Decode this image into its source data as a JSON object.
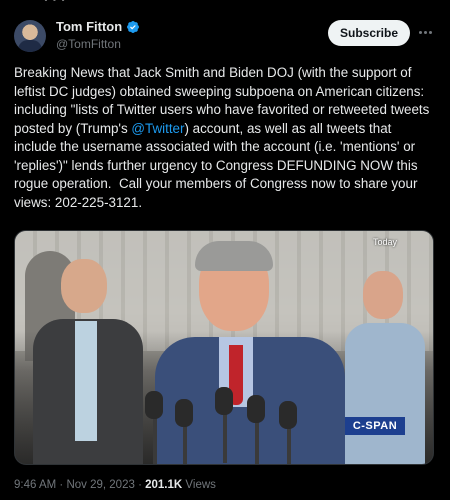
{
  "tweet": {
    "author_name": "Tom Fitton",
    "author_handle": "@TomFitton",
    "subscribe_label": "Subscribe",
    "text_before": "Breaking News that Jack Smith and Biden DOJ (with the support of leftist DC judges) obtained sweeping subpoena on American citizens: including \"lists of Twitter users who have favorited or retweeted tweets posted by (Trump's ",
    "mention": "@Twitter",
    "text_after": ") account, as well as all tweets that include the username associated with the account (i.e. 'mentions' or 'replies')\" lends further urgency to Congress DEFUNDING NOW this rogue operation.  Call your members of Congress now to share your views: 202-225-3121.",
    "time": "9:46 AM",
    "separator": "·",
    "date": "Nov 29, 2023",
    "views_count": "201.1K",
    "views_label": "Views"
  },
  "media": {
    "overlay_label": "Today",
    "network_logo_text": "C-SPAN"
  },
  "colors": {
    "background": "#000000",
    "text": "#e7e9ea",
    "secondary_text": "#71767b",
    "link": "#1d9bf0",
    "verified_badge": "#1d9bf0"
  },
  "icons": {
    "verified": "verified-badge-icon",
    "more": "more-options-icon"
  }
}
